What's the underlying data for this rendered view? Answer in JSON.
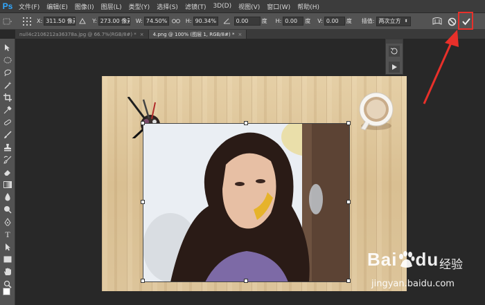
{
  "app": {
    "logo": "Ps"
  },
  "menu": [
    "文件(F)",
    "编辑(E)",
    "图像(I)",
    "图层(L)",
    "类型(Y)",
    "选择(S)",
    "滤镜(T)",
    "3D(D)",
    "视图(V)",
    "窗口(W)",
    "帮助(H)"
  ],
  "options": {
    "x_label": "X:",
    "x_value": "311.50 像素",
    "y_label": "Y:",
    "y_value": "273.00 像素",
    "w_label": "W:",
    "w_value": "74.50%",
    "h_label": "H:",
    "h_value": "90.34%",
    "angle_value": "0.00",
    "angle_unit": "度",
    "hskew_label": "H:",
    "hskew_value": "0.00",
    "hskew_unit": "度",
    "vskew_label": "V:",
    "vskew_value": "0.00",
    "vskew_unit": "度",
    "interp_label": "插值:",
    "interp_value": "两次立方"
  },
  "tabs": [
    {
      "label": "null4c2106212a36378a.jpg @ 66.7%(RGB/8#) *",
      "close": "×",
      "active": false
    },
    {
      "label": "4.png @ 100% (图层 1, RGB/8#) *",
      "close": "×",
      "active": true
    }
  ],
  "watermark": {
    "brand": "Bai",
    "brand_suffix": "du",
    "sub": "经验",
    "url": "jingyan.baidu.com"
  },
  "colors": {
    "highlight": "#e8302a",
    "accent": "#31a8ff"
  }
}
